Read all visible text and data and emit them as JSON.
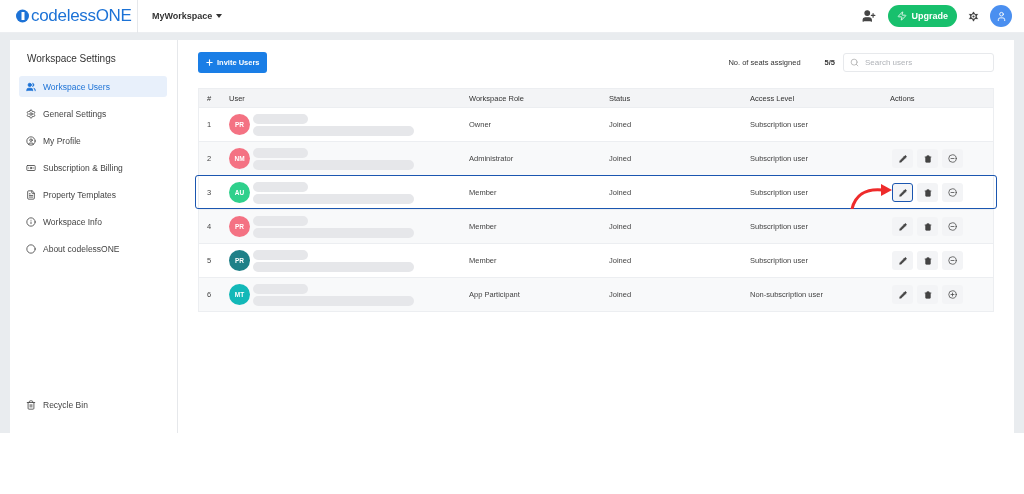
{
  "header": {
    "logo": "codelessONE",
    "workspace": "MyWorkspace",
    "upgrade": "Upgrade"
  },
  "sidebar": {
    "title": "Workspace Settings",
    "items": [
      {
        "label": "Workspace Users",
        "kind": "users",
        "selected": true
      },
      {
        "label": "General Settings",
        "kind": "gear",
        "selected": false
      },
      {
        "label": "My Profile",
        "kind": "profile",
        "selected": false
      },
      {
        "label": "Subscription & Billing",
        "kind": "billing",
        "selected": false
      },
      {
        "label": "Property Templates",
        "kind": "file",
        "selected": false
      },
      {
        "label": "Workspace Info",
        "kind": "info",
        "selected": false
      },
      {
        "label": "About codelessONE",
        "kind": "about",
        "selected": false
      }
    ],
    "bottom_item": {
      "label": "Recycle Bin",
      "kind": "bin",
      "selected": false
    }
  },
  "toolbar": {
    "invite": "Invite Users",
    "seats_label": "No. of seats assigned",
    "seats_value": "5/5",
    "search": {
      "placeholder": "Search users"
    }
  },
  "table": {
    "columns": [
      "#",
      "User",
      "Workspace Role",
      "Status",
      "Access Level",
      "Actions"
    ],
    "rows": [
      {
        "number": "1",
        "initials": "PR",
        "color": "#f47283",
        "role": "Owner",
        "status": "Joined",
        "access": "Subscription user",
        "actions": false,
        "highlighted": false
      },
      {
        "number": "2",
        "initials": "NM",
        "color": "#f47283",
        "role": "Administrator",
        "status": "Joined",
        "access": "Subscription user",
        "actions": true,
        "highlighted": false,
        "kind": "remove"
      },
      {
        "number": "3",
        "initials": "AU",
        "color": "#2fd08c",
        "role": "Member",
        "status": "Joined",
        "access": "Subscription user",
        "actions": true,
        "highlighted": true,
        "kind": "remove"
      },
      {
        "number": "4",
        "initials": "PR",
        "color": "#f47283",
        "role": "Member",
        "status": "Joined",
        "access": "Subscription user",
        "actions": true,
        "highlighted": false,
        "kind": "remove"
      },
      {
        "number": "5",
        "initials": "PR",
        "color": "#1f8088",
        "role": "Member",
        "status": "Joined",
        "access": "Subscription user",
        "actions": true,
        "highlighted": false,
        "kind": "remove"
      },
      {
        "number": "6",
        "initials": "MT",
        "color": "#12b8b8",
        "role": "App Participant",
        "status": "Joined",
        "access": "Non-subscription user",
        "actions": true,
        "highlighted": false,
        "kind": "add"
      }
    ]
  }
}
